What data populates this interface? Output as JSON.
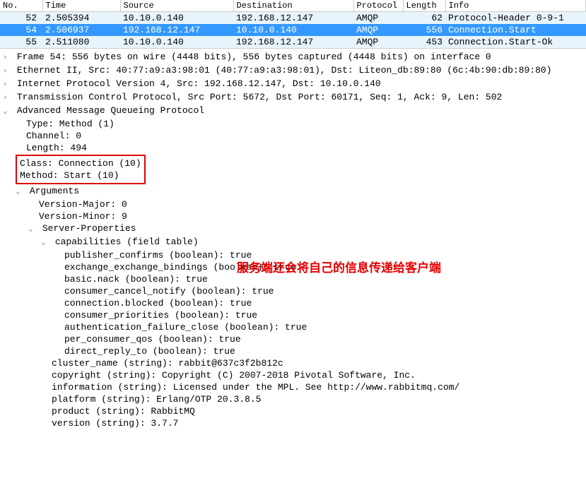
{
  "columns": [
    "No.",
    "Time",
    "Source",
    "Destination",
    "Protocol",
    "Length",
    "Info"
  ],
  "rows": [
    {
      "no": "52",
      "time": "2.505394",
      "src": "10.10.0.140",
      "dst": "192.168.12.147",
      "proto": "AMQP",
      "len": "62",
      "info": "Protocol-Header 0-9-1",
      "sel": false
    },
    {
      "no": "54",
      "time": "2.506937",
      "src": "192.168.12.147",
      "dst": "10.10.0.140",
      "proto": "AMQP",
      "len": "556",
      "info": "Connection.Start",
      "sel": true
    },
    {
      "no": "55",
      "time": "2.511080",
      "src": "10.10.0.140",
      "dst": "192.168.12.147",
      "proto": "AMQP",
      "len": "453",
      "info": "Connection.Start-Ok",
      "sel": false
    }
  ],
  "frame": "Frame 54: 556 bytes on wire (4448 bits), 556 bytes captured (4448 bits) on interface 0",
  "eth": "Ethernet II, Src: 40:77:a9:a3:98:01 (40:77:a9:a3:98:01), Dst: Liteon_db:89:80 (6c:4b:90:db:89:80)",
  "ip": "Internet Protocol Version 4, Src: 192.168.12.147, Dst: 10.10.0.140",
  "tcp": "Transmission Control Protocol, Src Port: 5672, Dst Port: 60171, Seq: 1, Ack: 9, Len: 502",
  "amqp_title": "Advanced Message Queueing Protocol",
  "amqp": {
    "type": "Type: Method (1)",
    "channel": "Channel: 0",
    "length": "Length: 494",
    "class": "Class: Connection (10)",
    "method": "Method: Start (10)",
    "args_title": "Arguments",
    "vmaj": "Version-Major: 0",
    "vmin": "Version-Minor: 9",
    "sprops_title": "Server-Properties",
    "caps_title": "capabilities (field table)",
    "caps": {
      "pc": "publisher_confirms (boolean): true",
      "eeb": "exchange_exchange_bindings (boolean): true",
      "bn": "basic.nack (boolean): true",
      "ccn": "consumer_cancel_notify (boolean): true",
      "cb": "connection.blocked (boolean): true",
      "cp": "consumer_priorities (boolean): true",
      "afc": "authentication_failure_close (boolean): true",
      "pcq": "per_consumer_qos (boolean): true",
      "drt": "direct_reply_to (boolean): true"
    },
    "cluster": "cluster_name (string): rabbit@637c3f2b812c",
    "copyright": "copyright (string): Copyright (C) 2007-2018 Pivotal Software, Inc.",
    "information": "information (string): Licensed under the MPL.  See http://www.rabbitmq.com/",
    "platform": "platform (string): Erlang/OTP 20.3.8.5",
    "product": "product (string): RabbitMQ",
    "version": "version (string): 3.7.7"
  },
  "annotation": "服务端还会将自己的信息传递给客户端",
  "glyph": {
    "closed": "›",
    "open": "⌄"
  }
}
